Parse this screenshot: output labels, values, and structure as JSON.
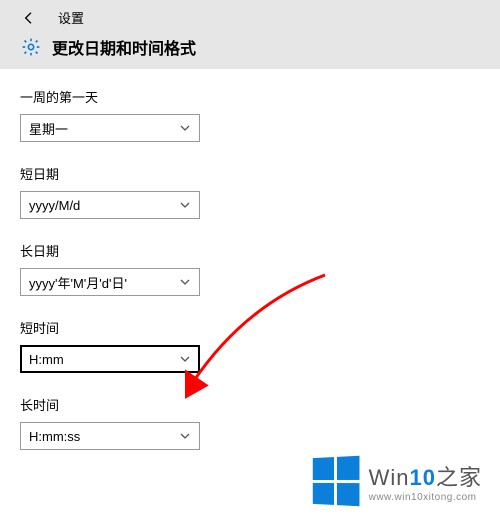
{
  "header": {
    "settings_label": "设置",
    "page_title": "更改日期和时间格式"
  },
  "fields": {
    "first_day": {
      "label": "一周的第一天",
      "value": "星期一"
    },
    "short_date": {
      "label": "短日期",
      "value": "yyyy/M/d"
    },
    "long_date": {
      "label": "长日期",
      "value": "yyyy'年'M'月'd'日'"
    },
    "short_time": {
      "label": "短时间",
      "value": "H:mm"
    },
    "long_time": {
      "label": "长时间",
      "value": "H:mm:ss"
    }
  },
  "watermark": {
    "brand_prefix": "Win",
    "brand_num": "10",
    "brand_suffix": "之家",
    "url": "www.win10xitong.com"
  },
  "colors": {
    "header_bg": "#e6e6e6",
    "accent": "#0b7fd9",
    "arrow": "#ff0000"
  }
}
